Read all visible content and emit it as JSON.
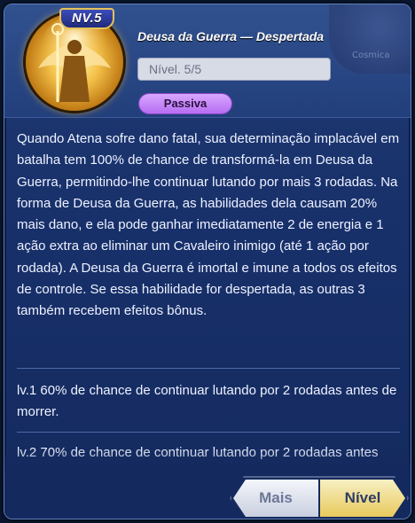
{
  "header": {
    "level_badge": "NV.5",
    "skill_title": "Deusa da Guerra — Despertada",
    "level_value": "Nível. 5/5",
    "type_pill": "Passiva",
    "corner_label": "Cosmica"
  },
  "description": "Quando Atena sofre dano fatal, sua determinação implacável em batalha tem 100% de chance de transformá-la em Deusa da Guerra, permitindo-lhe continuar lutando por mais 3 rodadas. Na forma de Deusa da Guerra, as habilidades dela causam 20% mais dano, e ela pode ganhar imediatamente 2 de energia e 1 ação extra ao eliminar um Cavaleiro inimigo (até 1 ação por rodada). A Deusa da Guerra é imortal e imune a todos os efeitos de controle. Se essa habilidade for despertada, as outras 3 também recebem efeitos bônus.",
  "levels": [
    {
      "text": "lv.1 60% de chance de continuar lutando por 2 rodadas antes de morrer."
    },
    {
      "text": "lv.2 70% de chance de continuar lutando por 2 rodadas antes"
    }
  ],
  "buttons": {
    "more": "Mais",
    "level": "Nível"
  },
  "colors": {
    "panel_bg": "#18306a",
    "pill_purple": "#b66ef1",
    "gold": "#e8c95c"
  }
}
